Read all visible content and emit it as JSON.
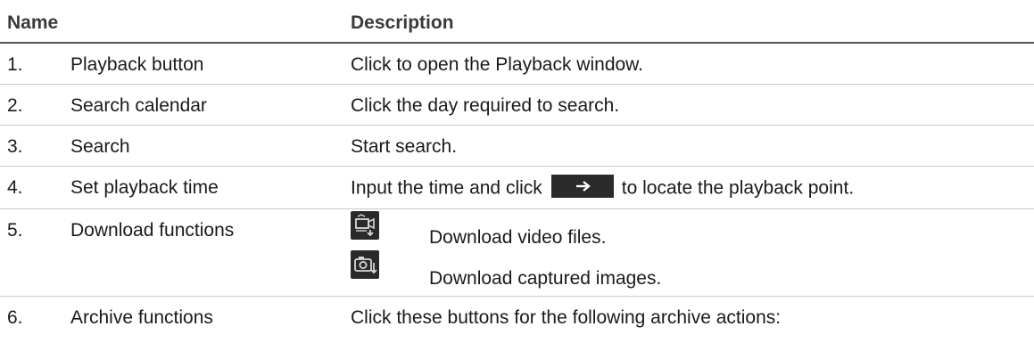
{
  "header": {
    "name": "Name",
    "description": "Description"
  },
  "rows": [
    {
      "num": "1.",
      "name": "Playback button",
      "desc": "Click to open the Playback window."
    },
    {
      "num": "2.",
      "name": "Search calendar",
      "desc": "Click the day required to search."
    },
    {
      "num": "3.",
      "name": "Search",
      "desc": "Start search."
    },
    {
      "num": "4.",
      "name": "Set playback time",
      "desc_before": "Input the time and click",
      "desc_after": "to locate the playback point.",
      "icon": "arrow-right-icon"
    },
    {
      "num": "5.",
      "name": "Download functions",
      "items": [
        {
          "icon": "download-video-icon",
          "text": "Download video files."
        },
        {
          "icon": "download-image-icon",
          "text": "Download captured images."
        }
      ]
    },
    {
      "num": "6.",
      "name": "Archive functions",
      "desc": "Click these buttons for the following archive actions:"
    }
  ],
  "colors": {
    "icon_bg": "#2b2b2b",
    "rule": "#c8c8c8",
    "header_rule": "#555555"
  }
}
